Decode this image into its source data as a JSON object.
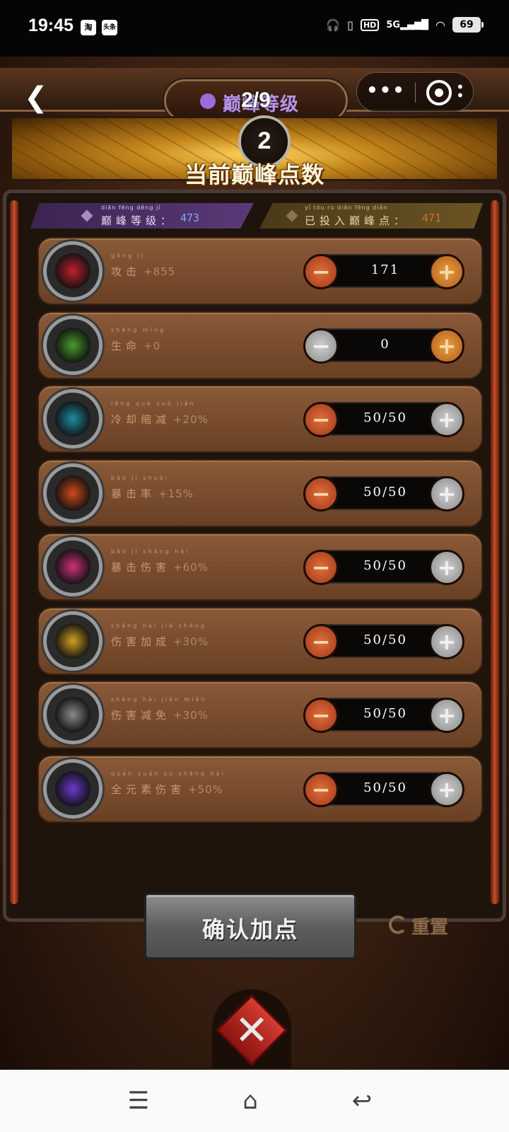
{
  "status_bar": {
    "time": "19:45",
    "app_badges": [
      "淘",
      "头条"
    ],
    "network": "5G",
    "hd": "HD",
    "battery": "69"
  },
  "header": {
    "title": "巅峰等级",
    "page_indicator": "2/9",
    "back_icon": "chevron-left-icon",
    "more_icon": "more-dots-icon",
    "close_icon": "target-close-icon"
  },
  "banner": {
    "points": "2",
    "title": "当前巅峰点数"
  },
  "info": {
    "level_pinyin": "diān fēng děng jí",
    "level_label": "巅峰等级：",
    "level_value": "473",
    "invested_pinyin": "yǐ tóu rù diān fēng diǎn",
    "invested_label": "已投入巅峰点：",
    "invested_value": "471",
    "level_color": "#7fa8ff",
    "invested_color": "#d07028"
  },
  "stats": [
    {
      "pinyin": "gōng jī",
      "label": "攻击",
      "bonus": "+855",
      "value": "171",
      "minus_disabled": false,
      "plus_disabled": false,
      "icon": "attack-target-icon",
      "color": "#c0202c"
    },
    {
      "pinyin": "shēng mìng",
      "label": "生命",
      "bonus": "+0",
      "value": "0",
      "minus_disabled": true,
      "plus_disabled": false,
      "icon": "health-cross-icon",
      "color": "#4a9a2a"
    },
    {
      "pinyin": "lěng què suō jiǎn",
      "label": "冷却缩减",
      "bonus": "+20%",
      "value": "50/50",
      "minus_disabled": false,
      "plus_disabled": true,
      "icon": "cooldown-clock-icon",
      "color": "#1e8ca0"
    },
    {
      "pinyin": "bào jī shuài",
      "label": "暴击率",
      "bonus": "+15%",
      "value": "50/50",
      "minus_disabled": false,
      "plus_disabled": true,
      "icon": "crit-rate-icon",
      "color": "#d04a1a"
    },
    {
      "pinyin": "bào jī shāng hài",
      "label": "暴击伤害",
      "bonus": "+60%",
      "value": "50/50",
      "minus_disabled": false,
      "plus_disabled": true,
      "icon": "crit-damage-icon",
      "color": "#d0307a"
    },
    {
      "pinyin": "shāng hài jiā chéng",
      "label": "伤害加成",
      "bonus": "+30%",
      "value": "50/50",
      "minus_disabled": false,
      "plus_disabled": true,
      "icon": "damage-bonus-icon",
      "color": "#d0a020"
    },
    {
      "pinyin": "shāng hài jiǎn miǎn",
      "label": "伤害减免",
      "bonus": "+30%",
      "value": "50/50",
      "minus_disabled": false,
      "plus_disabled": true,
      "icon": "shield-icon",
      "color": "#8a8a8a"
    },
    {
      "pinyin": "quán yuán sù shāng hài",
      "label": "全元素伤害",
      "bonus": "+50%",
      "value": "50/50",
      "minus_disabled": false,
      "plus_disabled": true,
      "icon": "elements-orb-icon",
      "color": "#6a3ad0"
    }
  ],
  "controls": {
    "confirm_label": "确认加点",
    "reset_label": "重置",
    "minus_glyph": "−",
    "plus_glyph": "+"
  },
  "nav": {
    "menu_icon": "menu-icon",
    "home_icon": "home-icon",
    "back_icon": "back-arrow-icon"
  }
}
